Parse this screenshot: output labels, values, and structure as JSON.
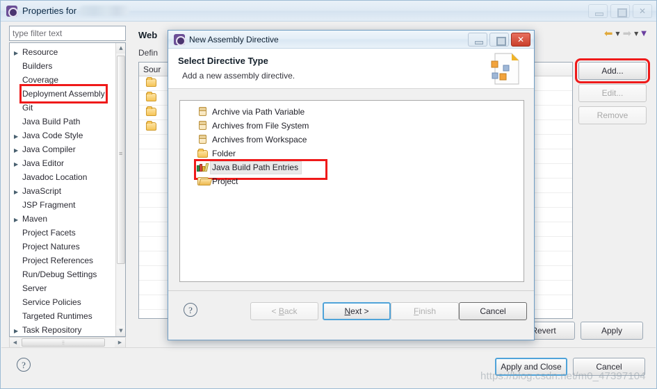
{
  "main_window": {
    "title": "Properties for",
    "project_name_blurred": "",
    "controls": {
      "minimize": "–",
      "maximize": "❐",
      "close": "✕"
    },
    "filter": {
      "placeholder": "type filter text",
      "value": "type filter text"
    },
    "toolbar": {
      "back_icon": "back-arrow-icon",
      "back_menu_icon": "chevron-down-icon",
      "forward_icon": "forward-arrow-icon",
      "forward_menu_icon": "chevron-down-icon",
      "view_menu_icon": "chevron-down-purple-icon"
    },
    "tree": {
      "items": [
        {
          "label": "Resource",
          "expandable": true,
          "selected": false
        },
        {
          "label": "Builders",
          "expandable": false,
          "selected": false
        },
        {
          "label": "Coverage",
          "expandable": false,
          "selected": false
        },
        {
          "label": "Deployment Assembly",
          "expandable": false,
          "selected": true
        },
        {
          "label": "Git",
          "expandable": false,
          "selected": false
        },
        {
          "label": "Java Build Path",
          "expandable": false,
          "selected": false
        },
        {
          "label": "Java Code Style",
          "expandable": true,
          "selected": false
        },
        {
          "label": "Java Compiler",
          "expandable": true,
          "selected": false
        },
        {
          "label": "Java Editor",
          "expandable": true,
          "selected": false
        },
        {
          "label": "Javadoc Location",
          "expandable": false,
          "selected": false
        },
        {
          "label": "JavaScript",
          "expandable": true,
          "selected": false
        },
        {
          "label": "JSP Fragment",
          "expandable": false,
          "selected": false
        },
        {
          "label": "Maven",
          "expandable": true,
          "selected": false
        },
        {
          "label": "Project Facets",
          "expandable": false,
          "selected": false
        },
        {
          "label": "Project Natures",
          "expandable": false,
          "selected": false
        },
        {
          "label": "Project References",
          "expandable": false,
          "selected": false
        },
        {
          "label": "Run/Debug Settings",
          "expandable": false,
          "selected": false
        },
        {
          "label": "Server",
          "expandable": false,
          "selected": false
        },
        {
          "label": "Service Policies",
          "expandable": false,
          "selected": false
        },
        {
          "label": "Targeted Runtimes",
          "expandable": false,
          "selected": false
        },
        {
          "label": "Task Repository",
          "expandable": true,
          "selected": false
        }
      ]
    },
    "content": {
      "page_title": "Web ",
      "description": "Defin",
      "table_header": "Sour",
      "folder_rows": 4,
      "empty_rows": 13,
      "buttons": {
        "add": "Add...",
        "edit": "Edit...",
        "remove": "Remove"
      }
    },
    "footer": {
      "help_icon": "?",
      "revert": "Revert",
      "apply": "Apply",
      "apply_and_close": "Apply and Close",
      "cancel": "Cancel"
    }
  },
  "dialog": {
    "title": "New Assembly Directive",
    "controls": {
      "minimize": "–",
      "maximize": "❐",
      "close": "✕"
    },
    "header": {
      "title": "Select Directive Type",
      "subtitle": "Add a new assembly directive."
    },
    "list": [
      {
        "label": "Archive via Path Variable",
        "icon": "jar-icon",
        "selected": false
      },
      {
        "label": "Archives from File System",
        "icon": "jar-icon",
        "selected": false
      },
      {
        "label": "Archives from Workspace",
        "icon": "jar-icon",
        "selected": false
      },
      {
        "label": "Folder",
        "icon": "folder-icon",
        "selected": false
      },
      {
        "label": "Java Build Path Entries",
        "icon": "books-icon",
        "selected": true
      },
      {
        "label": "Project",
        "icon": "project-folder-icon",
        "selected": false
      }
    ],
    "footer": {
      "help_icon": "?",
      "back": "< Back",
      "next": "Next >",
      "finish": "Finish",
      "cancel": "Cancel"
    }
  },
  "annotations": {
    "highlight_color": "#ef1a1a",
    "boxes": [
      "Deployment Assembly",
      "Add...",
      "Java Build Path Entries"
    ]
  },
  "watermark": {
    "text": "https://blog.csdn.net/m0_47397104"
  }
}
